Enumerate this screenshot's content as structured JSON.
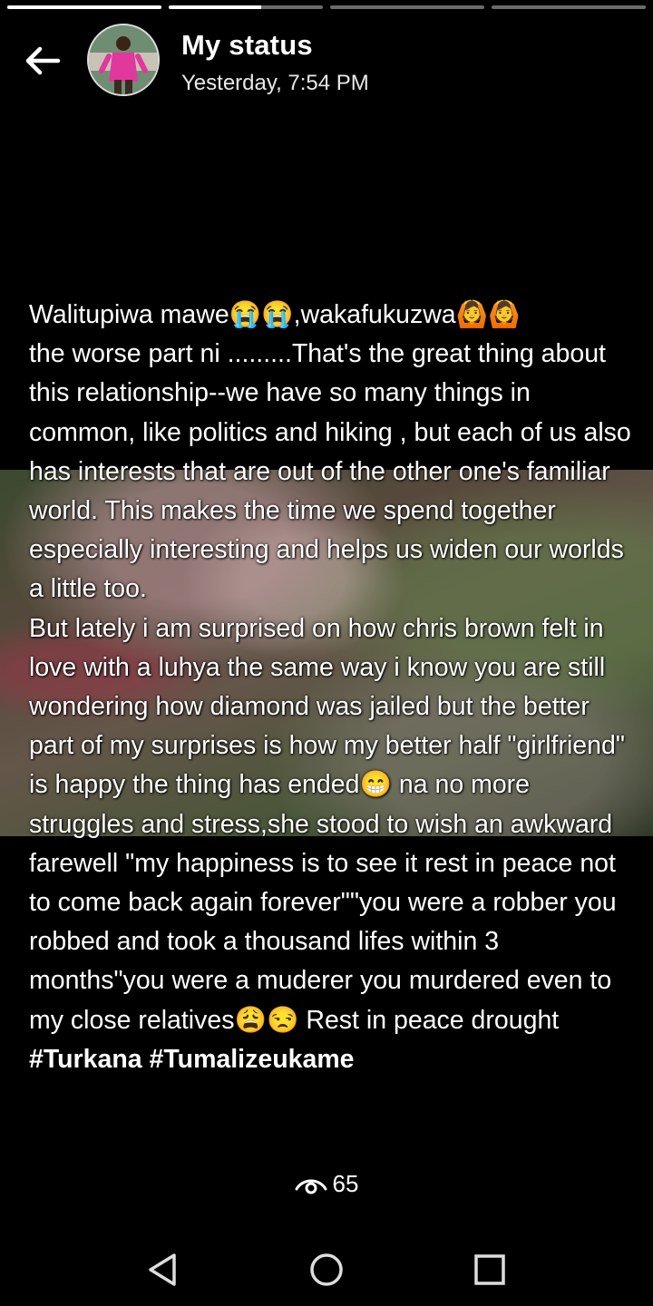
{
  "status": {
    "segments": [
      {
        "progress": 1.0
      },
      {
        "progress": 0.6
      },
      {
        "progress": 0.0
      },
      {
        "progress": 0.0
      }
    ]
  },
  "header": {
    "title": "My status",
    "timestamp": "Yesterday, 7:54 PM"
  },
  "post": {
    "text": "Walitupiwa mawe😭😭,wakafukuzwa🙆🙆\nthe worse part ni .........That's the great thing about this relationship--we have so many things in common, like politics and hiking , but each of us also has interests that are out of the other one's familiar world. This makes the time we spend together especially interesting and helps us widen our worlds a little too.\nBut lately i am surprised on how chris brown felt in love with a luhya the same way i know you are still wondering how diamond was jailed but the better part of my surprises is how my better half \"girlfriend\" is happy the thing has ended😁 na no more struggles and stress,she stood to wish an awkward farewell \"my happiness is to see it rest in peace not to come back again forever\"\"you were a robber you robbed and took a thousand lifes within 3 months\"you were a muderer you murdered even to my close relatives😩😒 Rest in peace drought ",
    "hashtags": "#Turkana #Tumalizeukame"
  },
  "footer": {
    "views_count": "65"
  },
  "icons": {
    "back": "arrow-left-icon",
    "views": "eye-icon",
    "nav_back": "triangle-back-icon",
    "nav_home": "circle-home-icon",
    "nav_recents": "square-recents-icon"
  }
}
